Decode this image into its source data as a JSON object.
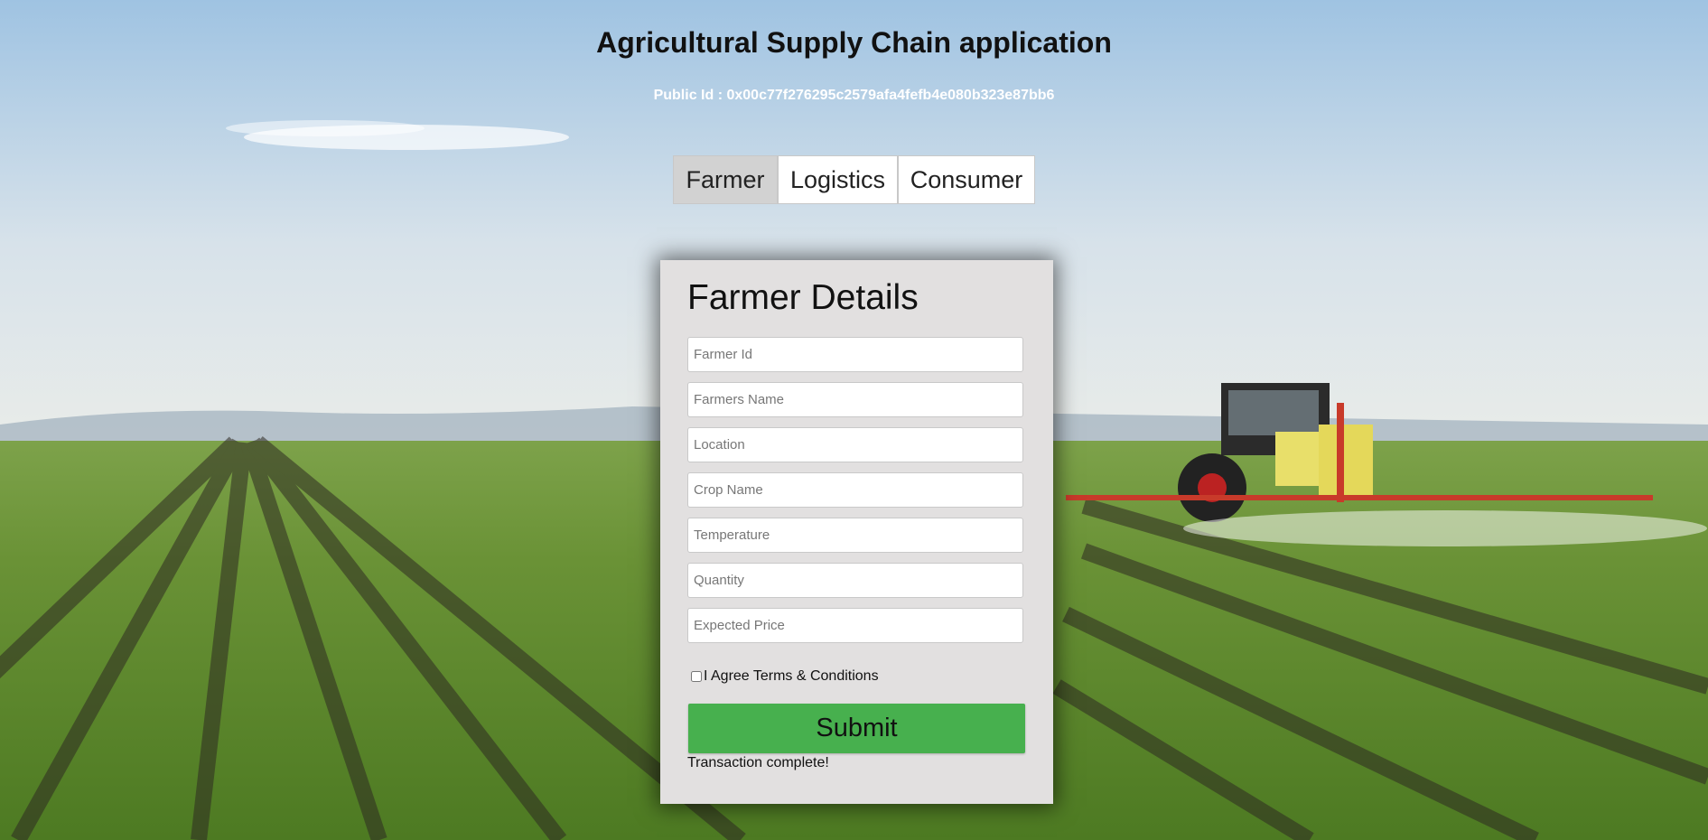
{
  "header": {
    "title": "Agricultural Supply Chain application",
    "public_id": "Public Id : 0x00c77f276295c2579afa4fefb4e080b323e87bb6"
  },
  "tabs": [
    {
      "label": "Farmer",
      "active": true
    },
    {
      "label": "Logistics",
      "active": false
    },
    {
      "label": "Consumer",
      "active": false
    }
  ],
  "form": {
    "heading": "Farmer Details",
    "fields": [
      {
        "placeholder": "Farmer Id",
        "value": ""
      },
      {
        "placeholder": "Farmers Name",
        "value": ""
      },
      {
        "placeholder": "Location",
        "value": ""
      },
      {
        "placeholder": "Crop Name",
        "value": ""
      },
      {
        "placeholder": "Temperature",
        "value": ""
      },
      {
        "placeholder": "Quantity",
        "value": ""
      },
      {
        "placeholder": "Expected Price",
        "value": ""
      }
    ],
    "agree_label": "I Agree Terms & Conditions",
    "agree_checked": false,
    "submit_label": "Submit",
    "status_text": "Transaction complete!"
  },
  "colors": {
    "submit": "#47b04e",
    "active_tab": "#d2d2d2",
    "card": "#e2e0e0"
  },
  "background": {
    "icon": "farm-field-tractor-image"
  }
}
